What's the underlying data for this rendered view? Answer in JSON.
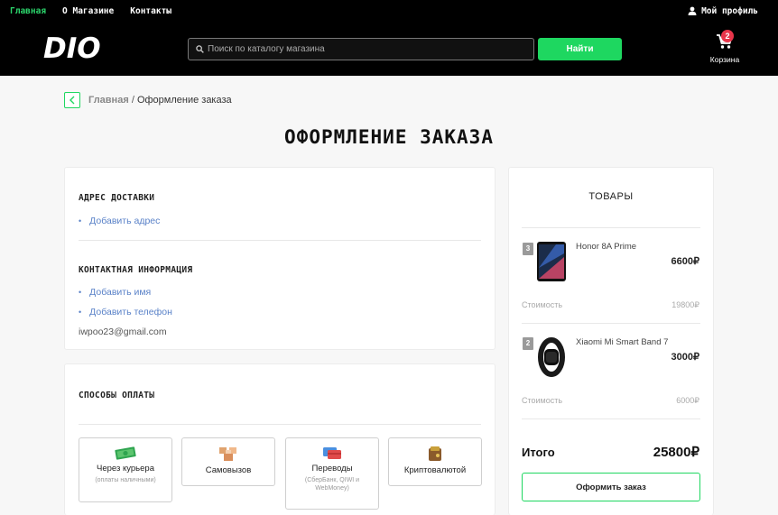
{
  "topnav": {
    "items": [
      {
        "label": "Главная",
        "active": true
      },
      {
        "label": "О Магазине",
        "active": false
      },
      {
        "label": "Контакты",
        "active": false
      }
    ],
    "profile_label": "Мой профиль"
  },
  "header": {
    "logo": "DIO",
    "search_placeholder": "Поиск по каталогу магазина",
    "search_button": "Найти",
    "cart_label": "Корзина",
    "cart_count": "2"
  },
  "breadcrumb": {
    "home": "Главная",
    "separator": "/",
    "current": "Оформление заказа"
  },
  "page_title": "ОФОРМЛЕНИЕ ЗАКАЗА",
  "delivery": {
    "title": "АДРЕС ДОСТАВКИ",
    "add_address": "Добавить адрес"
  },
  "contact": {
    "title": "КОНТАКТНАЯ ИНФОРМАЦИЯ",
    "add_name": "Добавить имя",
    "add_phone": "Добавить телефон",
    "email": "iwpoo23@gmail.com"
  },
  "payment": {
    "title": "СПОСОБЫ ОПЛАТЫ",
    "options": [
      {
        "title": "Через курьера",
        "subtitle": "(оплаты наличными)",
        "icon": "cash-icon"
      },
      {
        "title": "Самовызов",
        "subtitle": "",
        "icon": "box-icon"
      },
      {
        "title": "Переводы",
        "subtitle": "(СберБанк, QIWI и WebMoney)",
        "icon": "cards-icon"
      },
      {
        "title": "Криптовалютой",
        "subtitle": "",
        "icon": "wallet-icon"
      }
    ]
  },
  "goods": {
    "title": "ТОВАРЫ",
    "items": [
      {
        "qty": "3",
        "name": "Honor 8A Prime",
        "price": "6600₽",
        "cost_label": "Стоимость",
        "cost": "19800₽",
        "icon": "phone-icon"
      },
      {
        "qty": "2",
        "name": "Xiaomi Mi Smart Band 7",
        "price": "3000₽",
        "cost_label": "Стоимость",
        "cost": "6000₽",
        "icon": "band-icon"
      }
    ],
    "total_label": "Итого",
    "total": "25800₽",
    "order_button": "Оформить заказ"
  },
  "colors": {
    "accent": "#1ed760",
    "link": "#5a82c8",
    "badge": "#e8354a"
  }
}
